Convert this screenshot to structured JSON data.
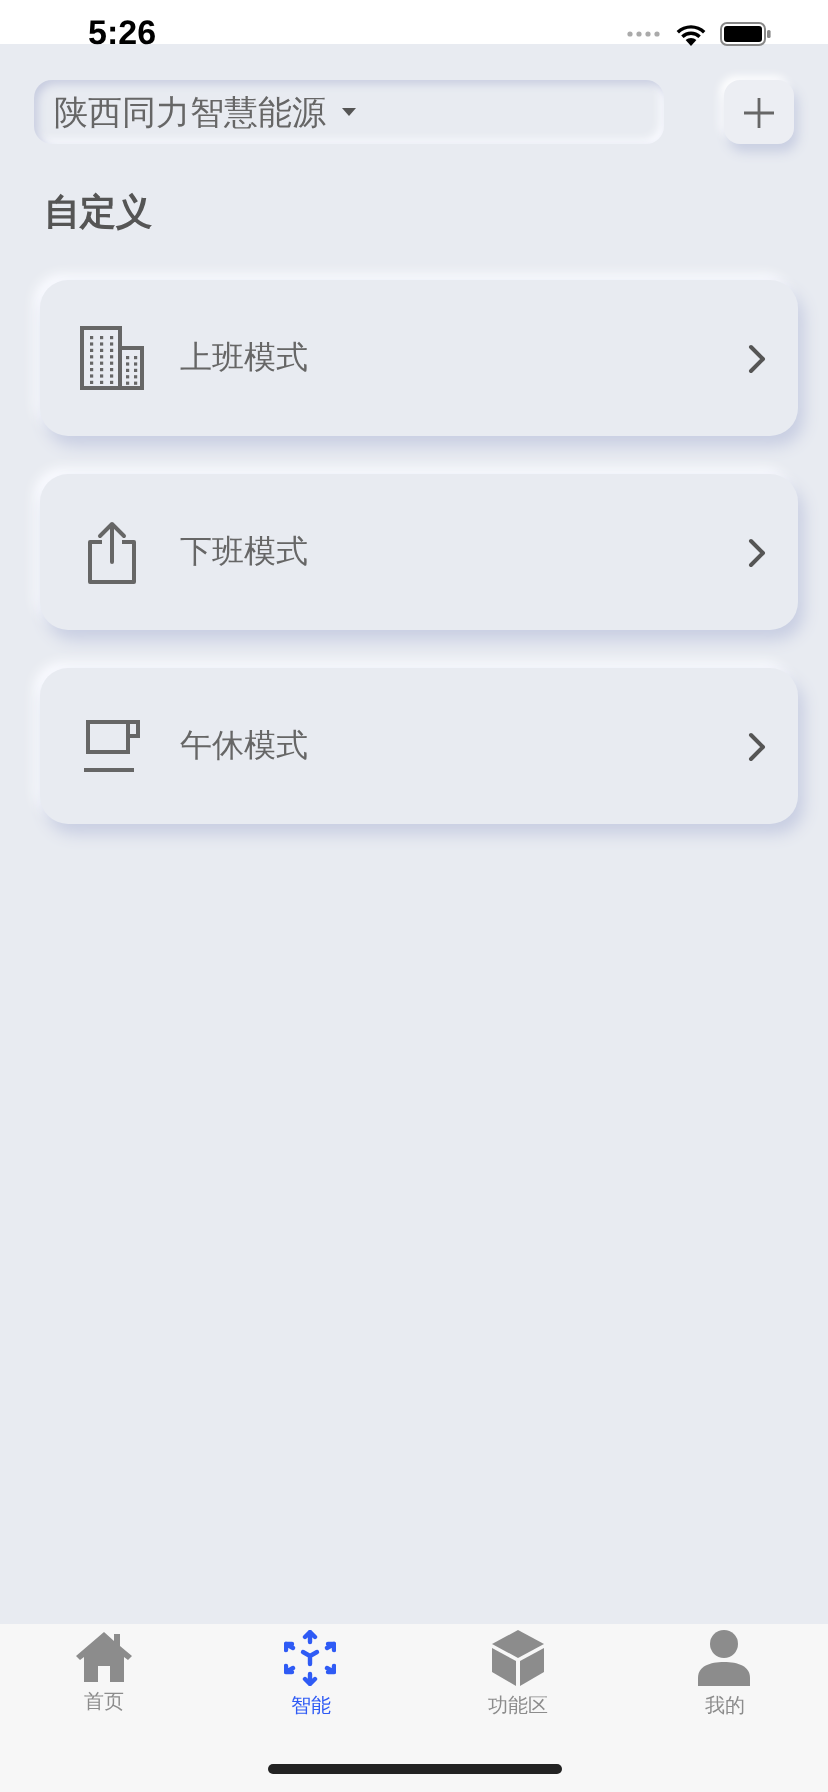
{
  "status_bar": {
    "time": "5:26"
  },
  "header": {
    "company": "陕西同力智慧能源"
  },
  "section_title": "自定义",
  "modes": [
    {
      "kind": "building",
      "label": "上班模式"
    },
    {
      "kind": "share",
      "label": "下班模式"
    },
    {
      "kind": "cup",
      "label": "午休模式"
    }
  ],
  "tabs": [
    {
      "label": "首页",
      "selected": false
    },
    {
      "label": "智能",
      "selected": true
    },
    {
      "label": "功能区",
      "selected": false
    },
    {
      "label": "我的",
      "selected": false
    }
  ]
}
